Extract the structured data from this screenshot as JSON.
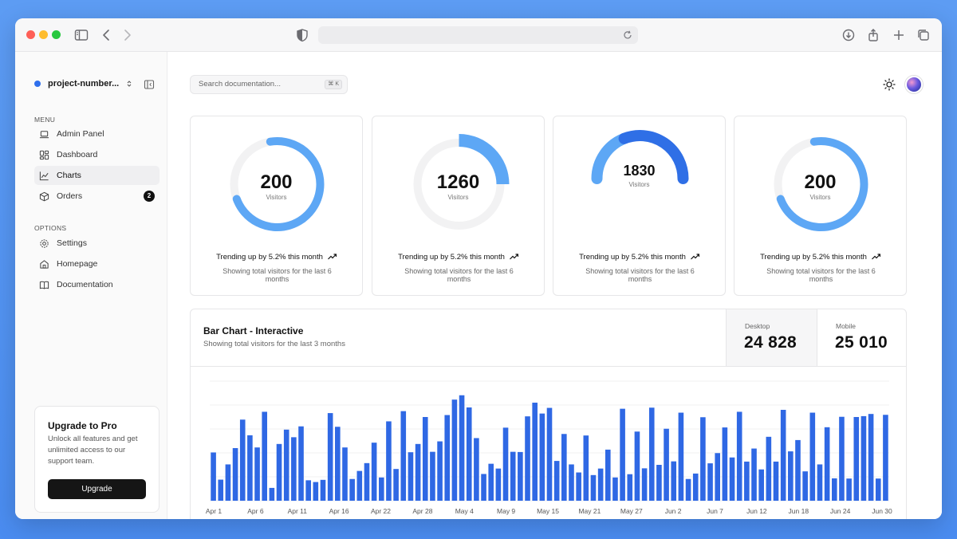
{
  "browser": {
    "address": "",
    "icons": [
      "sidebar-toggle-icon",
      "back-icon",
      "forward-icon",
      "shield-icon",
      "reload-icon",
      "download-icon",
      "share-icon",
      "new-tab-icon",
      "tabs-icon"
    ]
  },
  "sidebar": {
    "project_name": "project-number...",
    "menu_label": "MENU",
    "options_label": "OPTIONS",
    "menu_items": [
      {
        "label": "Admin Panel",
        "icon": "laptop-icon"
      },
      {
        "label": "Dashboard",
        "icon": "dashboard-icon"
      },
      {
        "label": "Charts",
        "icon": "chart-icon",
        "active": true
      },
      {
        "label": "Orders",
        "icon": "box-icon",
        "badge": "2"
      }
    ],
    "option_items": [
      {
        "label": "Settings",
        "icon": "settings-icon"
      },
      {
        "label": "Homepage",
        "icon": "home-icon"
      },
      {
        "label": "Documentation",
        "icon": "book-icon"
      }
    ],
    "upgrade": {
      "title": "Upgrade to Pro",
      "text": "Unlock all features and get unlimited access to our support team.",
      "button": "Upgrade"
    }
  },
  "header": {
    "search_placeholder": "Search documentation...",
    "search_shortcut": "⌘ K"
  },
  "cards": [
    {
      "value": "200",
      "unit": "Visitors",
      "trend": "Trending up by 5.2% this month",
      "desc": "Showing total visitors for the last 6 months",
      "progress": 0.72
    },
    {
      "value": "1260",
      "unit": "Visitors",
      "trend": "Trending up by 5.2% this month",
      "desc": "Showing total visitors for the last 6 months",
      "progress": 0.25
    },
    {
      "value": "1830",
      "unit": "Visitors",
      "trend": "Trending up by 5.2% this month",
      "desc": "Showing total visitors for the last 6 months",
      "progress": 0.62
    },
    {
      "value": "200",
      "unit": "Visitors",
      "trend": "Trending up by 5.2% this month",
      "desc": "Showing total visitors for the last 6 months",
      "progress": 0.72
    }
  ],
  "colors": {
    "gauge_light": "#5da7f5",
    "gauge_dark": "#2f6fe6",
    "gauge_track": "#f2f2f3",
    "bar": "#2f68e4",
    "accent": "#2f6fec"
  },
  "bar_chart": {
    "title": "Bar Chart - Interactive",
    "subtitle": "Showing total visitors for the last 3 months",
    "desktop_label": "Desktop",
    "desktop_total": "24 828",
    "mobile_label": "Mobile",
    "mobile_total": "25 010"
  },
  "chart_data": {
    "type": "bar",
    "title": "Bar Chart - Interactive",
    "series": [
      {
        "name": "Desktop",
        "values": [
          222,
          97,
          167,
          242,
          373,
          301,
          245,
          409,
          59,
          261,
          327,
          292,
          342,
          94,
          86,
          96,
          403,
          340,
          245,
          100,
          137,
          173,
          267,
          107,
          365,
          146,
          412,
          223,
          261,
          385,
          225,
          273,
          394,
          465,
          485,
          429,
          288,
          123,
          170,
          148,
          336,
          225,
          224,
          388,
          451,
          401,
          427,
          183,
          307,
          167,
          130,
          300,
          118,
          148,
          235,
          107,
          423,
          122,
          318,
          149,
          428,
          165,
          331,
          181,
          405,
          100,
          125,
          384,
          172,
          219,
          337,
          199,
          409,
          180,
          240,
          144,
          294,
          180,
          418,
          227,
          279,
          135,
          405,
          167,
          338,
          103,
          386,
          102,
          385,
          389,
          399,
          102,
          395
        ]
      }
    ],
    "ylim": [
      0,
      550
    ],
    "x_tick_labels": [
      "Apr 1",
      "Apr 6",
      "Apr 11",
      "Apr 16",
      "Apr 22",
      "Apr 28",
      "May 4",
      "May 9",
      "May 15",
      "May 21",
      "May 27",
      "Jun 2",
      "Jun 7",
      "Jun 12",
      "Jun 18",
      "Jun 24",
      "Jun 30"
    ],
    "grid": true
  }
}
